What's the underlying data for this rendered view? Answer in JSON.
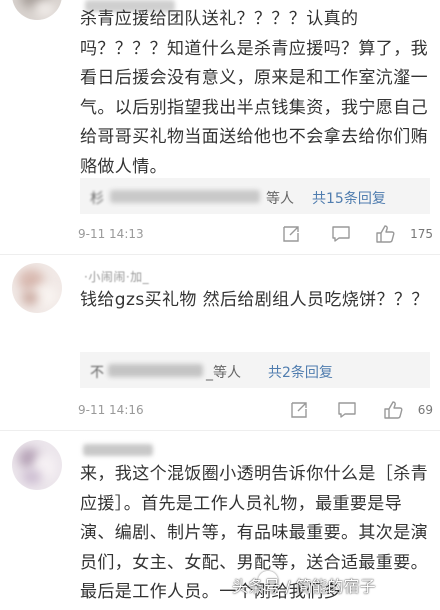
{
  "comments": [
    {
      "name_hint": "",
      "text": "杀青应援给团队送礼？？？？认真的吗？？？？知道什么是杀青应援吗？算了，我看日后援会没有意义，原来是和工作室沆瀣一气。以后别指望我出半点钱集资，我宁愿自己给哥哥买礼物当面送给他也不会拿去给你们贿赂做人情。",
      "reply_prefix": "杉",
      "reply_suffix": "等人",
      "reply_count": "共15条回复",
      "reply_count_num": 15,
      "time": "9-11  14:13",
      "likes": "175"
    },
    {
      "name_hint": "·小闹闹·加_",
      "text": "钱给gzs买礼物 然后给剧组人员吃烧饼？？？",
      "reply_prefix": "不",
      "reply_suffix": "_等人",
      "reply_count": "共2条回复",
      "reply_count_num": 2,
      "time": "9-11  14:16",
      "likes": "69"
    },
    {
      "name_hint": "",
      "text": "来，我这个混饭圈小透明告诉你什么是［杀青应援］。首先是工作人员礼物，最重要是导演、编剧、制片等，有品味最重要。其次是演员们，女主、女配、男配等，送合适最重要。最后是工作人员。一个刚给我们多"
    }
  ],
  "icons": {
    "share": "share-icon",
    "comment": "comment-icon",
    "like": "thumbs-up-icon"
  },
  "watermark": {
    "text": "头条号 / 简能的宿子"
  },
  "colors": {
    "text": "#333333",
    "meta": "#999999",
    "reply_bg": "#f4f4f4",
    "reply_count": "#507daf"
  }
}
